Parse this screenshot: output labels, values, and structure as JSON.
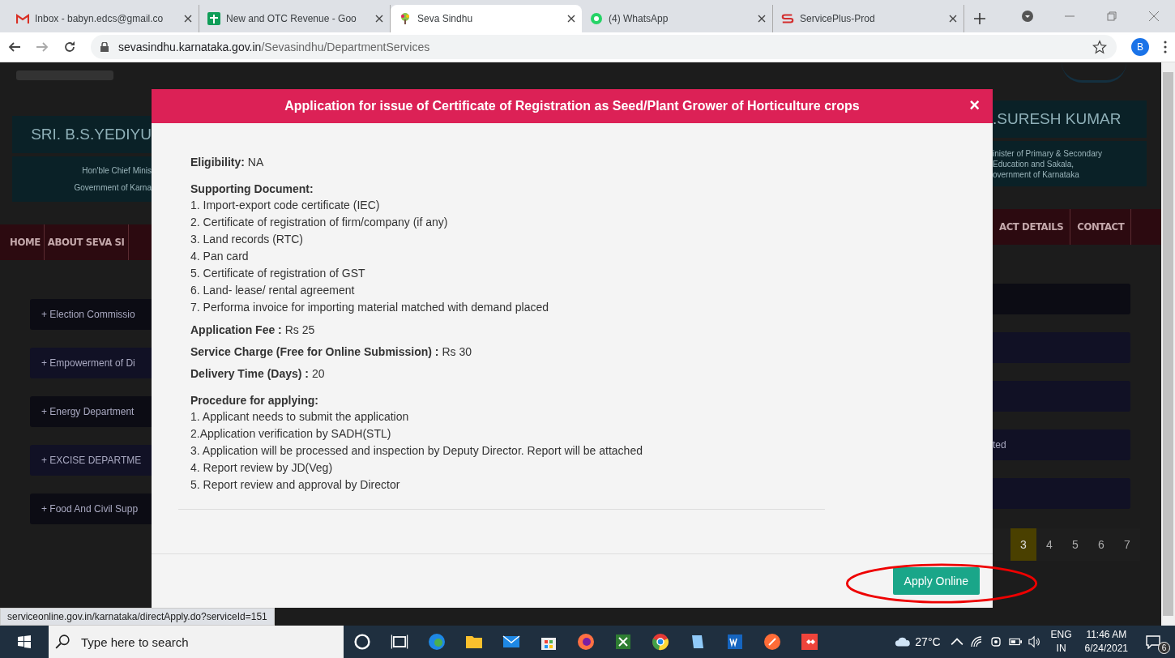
{
  "browser": {
    "tabs": [
      {
        "title": "Inbox - babyn.edcs@gmail.co",
        "kind": "mail",
        "selected": false
      },
      {
        "title": "New and OTC Revenue - Goo",
        "kind": "sheet",
        "selected": false
      },
      {
        "title": "Seva Sindhu",
        "kind": "tree",
        "selected": true
      },
      {
        "title": "(4) WhatsApp",
        "kind": "chat",
        "selected": false
      },
      {
        "title": "ServicePlus-Prod",
        "kind": "logo",
        "selected": false
      }
    ],
    "url_host": "sevasindhu.karnataka.gov.in",
    "url_path": "/Sevasindhu/DepartmentServices",
    "profile": "B"
  },
  "page": {
    "left": {
      "banner_name": "SRI. B.S.YEDIYU",
      "banner_lines": [
        "Hon'ble Chief Minis",
        "Government of Karna"
      ],
      "nav": [
        "HOME",
        "ABOUT SEVA SI"
      ],
      "departments": [
        {
          "left": "+ Election Commissio"
        },
        {
          "left": "+ Empowerment of Di"
        },
        {
          "left": "+ Energy Department"
        },
        {
          "left": "+ EXCISE DEPARTME",
          "right": "ted"
        },
        {
          "left": "+ Food And Civil Supp"
        }
      ]
    },
    "right": {
      "banner_name": ".SURESH KUMAR",
      "banner_lines": [
        "inister of Primary & Secondary",
        "Education and Sakala,",
        "overnment of Karnataka"
      ],
      "nav": [
        "ACT DETAILS",
        "CONTACT"
      ]
    },
    "pagination": [
      {
        "label": "3",
        "selected": true
      },
      {
        "label": "4",
        "selected": false
      },
      {
        "label": "5",
        "selected": false
      },
      {
        "label": "6",
        "selected": false
      },
      {
        "label": "7",
        "selected": false
      }
    ]
  },
  "modal": {
    "title": "Application for issue of Certificate of Registration as Seed/Plant Grower of Horticulture crops",
    "close": "×",
    "sections": [
      {
        "kind": "field",
        "label": "Eligibility:",
        "value": "NA"
      },
      {
        "kind": "list",
        "label": "Supporting Document:",
        "items": [
          "1. Import-export code certificate (IEC)",
          "2. Certificate of registration of firm/company (if any)",
          "3. Land records (RTC)",
          "4. Pan card",
          "5. Certificate of registration of GST",
          "6. Land- lease/ rental agreement",
          "7. Performa invoice for importing material matched with demand placed"
        ]
      },
      {
        "kind": "field",
        "label": "Application Fee :",
        "value": "Rs 25"
      },
      {
        "kind": "field",
        "label": "Service Charge (Free for Online Submission) :",
        "value": "Rs 30"
      },
      {
        "kind": "field",
        "label": "Delivery Time (Days) :",
        "value": "20"
      },
      {
        "kind": "list",
        "label": "Procedure for applying:",
        "items": [
          "1. Applicant needs to submit the application",
          "2.Application verification by SADH(STL)",
          "3. Application will be processed and inspection by Deputy Director. Report will be attached",
          "4. Report review by JD(Veg)",
          "5. Report review and approval by Director"
        ]
      }
    ],
    "apply_button": "Apply Online"
  },
  "status_url": "serviceonline.gov.in/karnataka/directApply.do?serviceId=151",
  "taskbar": {
    "search_placeholder": "Type here to search",
    "temperature": "27°C",
    "language": [
      "ENG",
      "IN"
    ],
    "time": "11:46 AM",
    "date": "6/24/2021",
    "notifications": "6"
  }
}
